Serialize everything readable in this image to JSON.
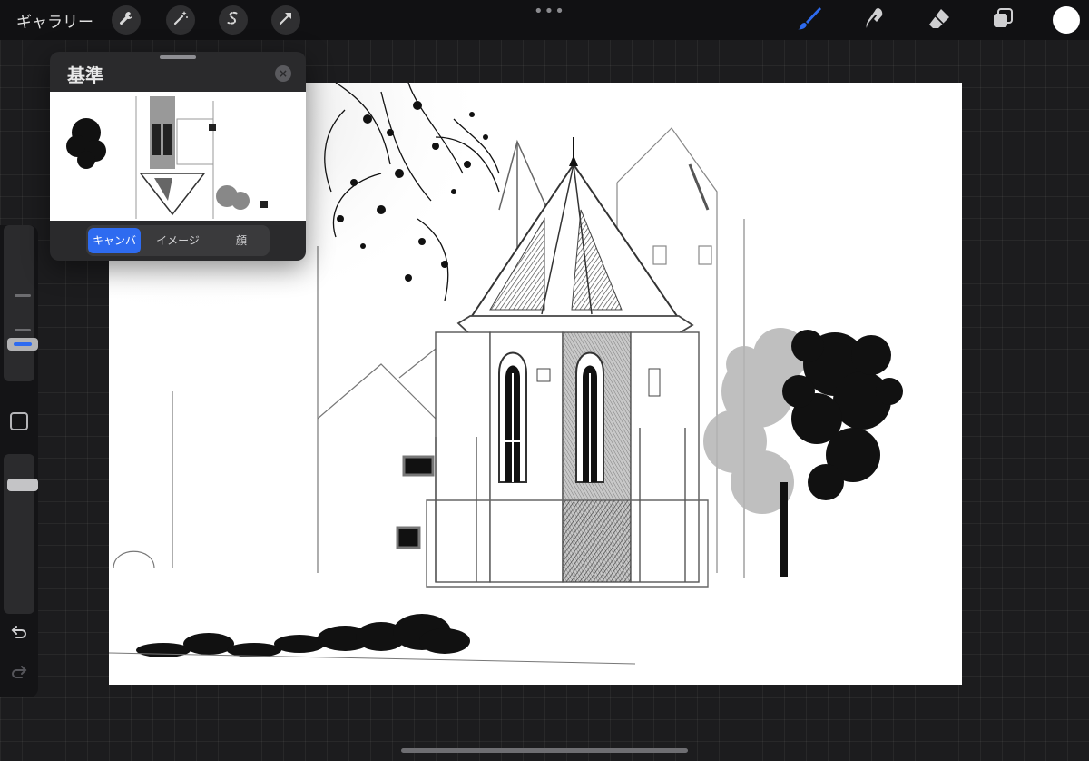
{
  "topbar": {
    "gallery_label": "ギャラリー",
    "more_label": "•••",
    "tools": [
      "wrench-icon",
      "magic-wand-icon",
      "selection-icon",
      "transform-arrow-icon"
    ],
    "right_tools": [
      "brush-icon",
      "smudge-icon",
      "eraser-icon",
      "layers-icon"
    ],
    "active_tool": "brush-icon",
    "accent_color": "#2e6bf0",
    "current_color": "#ffffff"
  },
  "reference_panel": {
    "title": "基準",
    "close_icon": "close-icon",
    "tabs": [
      {
        "label": "キャンバス",
        "active": true
      },
      {
        "label": "イメージ",
        "active": false
      },
      {
        "label": "顔",
        "active": false
      }
    ]
  },
  "sidebar": {
    "brush_size_level": 0.2,
    "opacity_level": 0.85,
    "modify_button_icon": "square-icon",
    "undo_icon": "undo-icon",
    "redo_icon": "redo-icon"
  },
  "canvas": {
    "subject": "church-sketch"
  }
}
